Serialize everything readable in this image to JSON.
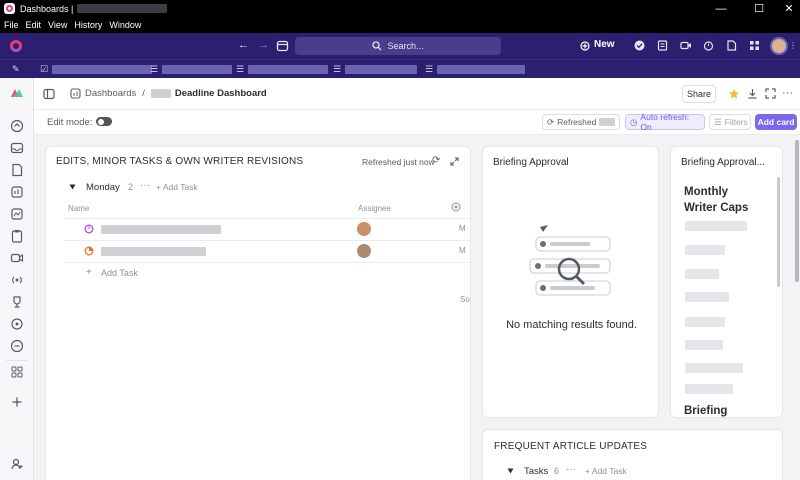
{
  "window": {
    "title": "Dashboards |",
    "minimize_glyph": "—",
    "maximize_glyph": "☐",
    "close_glyph": "✕"
  },
  "menu": [
    "File",
    "Edit",
    "View",
    "History",
    "Window"
  ],
  "topnav": {
    "search_placeholder": "Search...",
    "new_label": "New",
    "back_glyph": "←",
    "forward_glyph": "→"
  },
  "header": {
    "breadcrumb_root": "Dashboards",
    "breadcrumb_sep": "/",
    "dashboard_name": "Deadline Dashboard",
    "share_label": "Share",
    "more_glyph": "···"
  },
  "toolbar": {
    "edit_mode_label": "Edit mode:",
    "refreshed_label": "Refreshed",
    "auto_refresh_label": "Auto refresh: On",
    "filters_label": "Filters",
    "add_card_label": "Add card"
  },
  "card_tasks": {
    "title": "EDITS, MINOR TASKS & OWN WRITER REVISIONS",
    "refreshed": "Refreshed just now",
    "group_name": "Monday",
    "group_count": "2",
    "add_task": "+ Add Task",
    "col_name": "Name",
    "col_assignee": "Assignee",
    "truncated_m1": "M",
    "truncated_m2": "M",
    "truncated_so": "So",
    "add_task_row": "Add Task"
  },
  "card_briefing": {
    "title": "Briefing Approval",
    "empty_text": "No matching results found."
  },
  "card_briefing2": {
    "title": "Briefing Approval...",
    "heading1": "Monthly Writer Caps",
    "heading2": "Briefing"
  },
  "card_updates": {
    "title": "FREQUENT ARTICLE UPDATES",
    "group_name": "Tasks",
    "group_count": "6",
    "add_task": "+ Add Task"
  },
  "colors": {
    "accent": "#7b68ee",
    "nav_bg": "#2c1f6f"
  }
}
